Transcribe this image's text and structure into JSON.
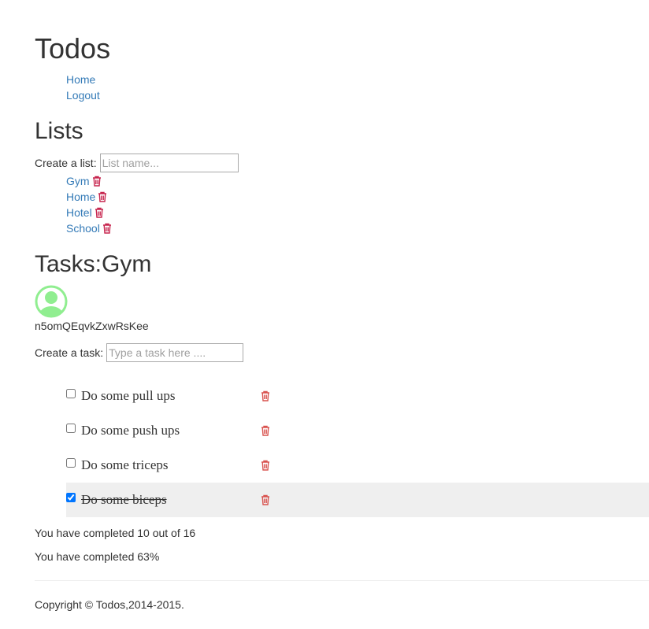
{
  "app": {
    "title": "Todos"
  },
  "nav": {
    "home": "Home",
    "logout": "Logout"
  },
  "lists": {
    "heading": "Lists",
    "create_label": "Create a list:",
    "create_placeholder": "List name...",
    "items": [
      {
        "label": "Gym"
      },
      {
        "label": "Home"
      },
      {
        "label": "Hotel"
      },
      {
        "label": "School"
      }
    ]
  },
  "tasks": {
    "heading": "Tasks:Gym",
    "username": "n5omQEqvkZxwRsKee",
    "create_label": "Create a task:",
    "create_placeholder": "Type a task here ....",
    "items": [
      {
        "text": "Do some pull ups",
        "done": false
      },
      {
        "text": "Do some push ups",
        "done": false
      },
      {
        "text": "Do some triceps",
        "done": false
      },
      {
        "text": "Do some biceps",
        "done": true
      }
    ]
  },
  "stats": {
    "completed_count": "You have completed 10 out of 16",
    "completed_percent": "You have completed 63%"
  },
  "footer": {
    "copyright": "Copyright © Todos,2014-2015."
  },
  "colors": {
    "link": "#337ab7",
    "trash_list": "#c7254e",
    "trash_task": "#d9534f",
    "avatar": "#90ee90",
    "done_row": "#efefef"
  },
  "icons": {
    "trash": "trash-icon",
    "avatar": "user-avatar-icon"
  }
}
